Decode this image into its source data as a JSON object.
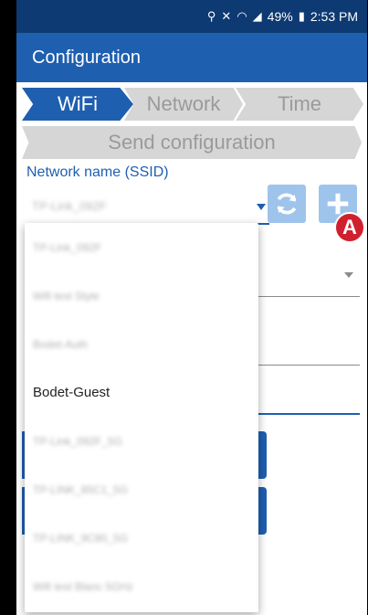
{
  "status_bar": {
    "icons": [
      "location-icon",
      "mute-icon",
      "wifi-icon",
      "signal-icon",
      "battery-icon"
    ],
    "battery": "49%",
    "time": "2:53 PM"
  },
  "app_bar": {
    "title": "Configuration"
  },
  "steps": {
    "wifi": "WiFi",
    "network": "Network",
    "time": "Time",
    "send": "Send configuration"
  },
  "form": {
    "ssid_label": "Network name (SSID)",
    "ssid_value": "TP-Link_092F"
  },
  "badge": "A",
  "dropdown": {
    "items": [
      "TP-Link_092F",
      "Wifi test Style",
      "Bodet-Auth",
      "Bodet-Guest",
      "TP-Link_092F_5G",
      "TP-LINK_85C1_5G",
      "TP-LINK_9C80_5G",
      "Wifi test Blanc 5GHz"
    ]
  },
  "colors": {
    "status_bar": "#0e3a73",
    "app_bar": "#1f5fb0",
    "step_active": "#1f5fb0",
    "step_inactive": "#d6d6d6",
    "icon_button": "#9fc4ec",
    "badge": "#d0202e"
  }
}
